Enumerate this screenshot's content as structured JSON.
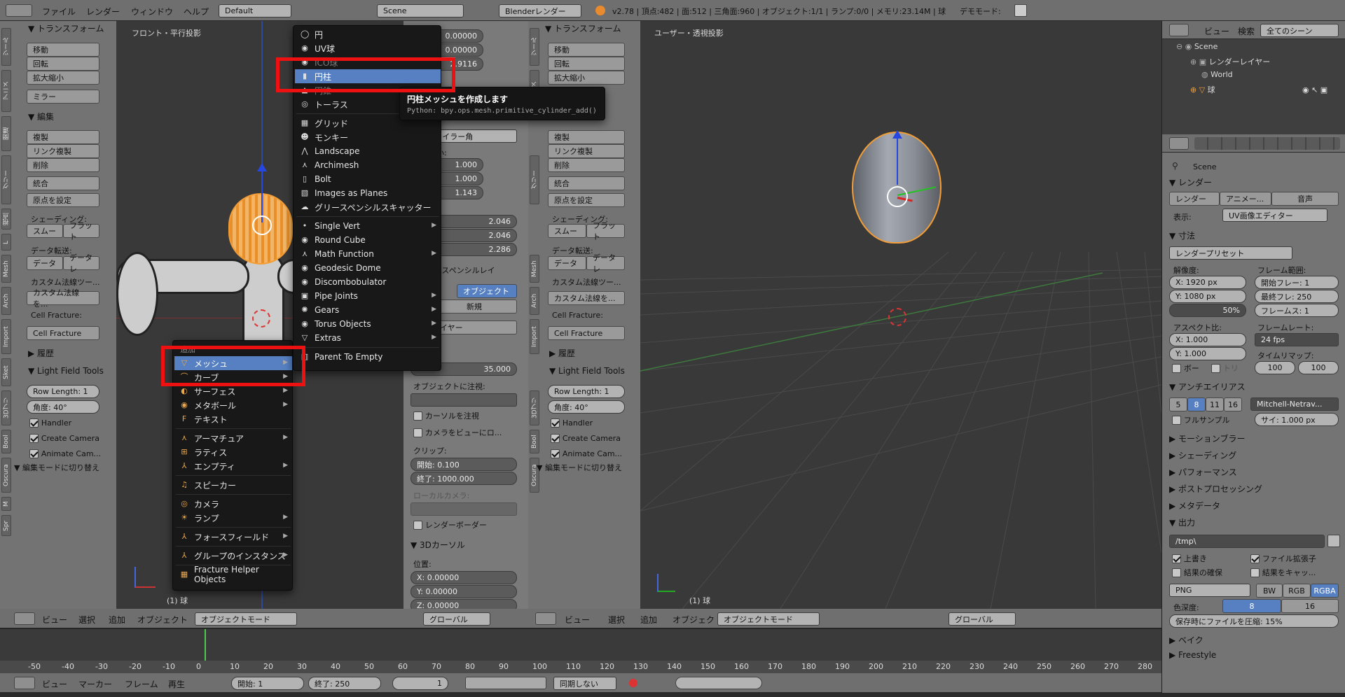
{
  "topbar": {
    "menus": [
      "ファイル",
      "レンダー",
      "ウィンドウ",
      "ヘルプ"
    ],
    "layout": "Default",
    "scene": "Scene",
    "engine": "Blenderレンダー",
    "stats": "v2.78 | 頂点:482 | 面:512 | 三角面:960 | オブジェクト:1/1 | ランプ:0/0 | メモリ:23.14M | 球",
    "demo": "デモモード:"
  },
  "left_tool": {
    "transform_header": "▼ トランスフォーム",
    "transform_btns": [
      "移動",
      "回転",
      "拡大縮小"
    ],
    "mirror": "ミラー",
    "edit_header": "▼ 編集",
    "edit_btns": [
      "複製",
      "リンク複製",
      "削除"
    ],
    "join": "統合",
    "origin": "原点を設定",
    "shading_label": "シェーディング:",
    "shading_btns": [
      "スムー",
      "フラット"
    ],
    "transfer_label": "データ転送:",
    "transfer_btns": [
      "データ",
      "データレ"
    ],
    "custom_label": "カスタム法線ツー...",
    "custom_btn": "カスタム法線を...",
    "cell_label": "Cell Fracture:",
    "cell_btn": "Cell Fracture",
    "history": "▶ 履歴",
    "lft_header": "▼ Light Field Tools",
    "row_length": "Row Length: 1",
    "angle": "角度:          40°",
    "checks": [
      "Handler",
      "Create Camera",
      "Animate Cam..."
    ],
    "editmode": "▼ 編集モードに切り替え"
  },
  "left_vp": {
    "title": "フロント・平行投影",
    "obj": "(1) 球"
  },
  "add_menu": {
    "title": "追加",
    "items": [
      {
        "label": "メッシュ",
        "sub": true,
        "sel": true
      },
      {
        "label": "カーブ",
        "sub": true
      },
      {
        "label": "サーフェス",
        "sub": true
      },
      {
        "label": "メタボール",
        "sub": true
      },
      {
        "label": "テキスト"
      },
      {
        "label": "アーマチュア",
        "sub": true
      },
      {
        "label": "ラティス"
      },
      {
        "label": "エンプティ",
        "sub": true
      },
      {
        "label": "スピーカー"
      },
      {
        "label": "カメラ"
      },
      {
        "label": "ランプ",
        "sub": true
      },
      {
        "label": "フォースフィールド",
        "sub": true
      },
      {
        "label": "グループのインスタンス",
        "sub": true
      },
      {
        "label": "Fracture Helper Objects"
      }
    ]
  },
  "mesh_menu": {
    "items": [
      {
        "label": "円",
        "icon": "circle-icon"
      },
      {
        "label": "UV球",
        "icon": "uv-sphere-icon"
      },
      {
        "label": "ICO球",
        "icon": "ico-sphere-icon"
      },
      {
        "label": "円柱",
        "icon": "cylinder-icon"
      },
      {
        "label": "円錐",
        "icon": "cone-icon"
      },
      {
        "label": "トーラス",
        "icon": "torus-icon"
      },
      {
        "label": "グリッド",
        "icon": "grid-icon"
      },
      {
        "label": "モンキー",
        "icon": "monkey-icon"
      },
      {
        "label": "Landscape",
        "icon": "landscape-icon"
      },
      {
        "label": "Archimesh",
        "icon": "archimesh-icon"
      },
      {
        "label": "Bolt",
        "icon": "bolt-icon"
      },
      {
        "label": "Images as Planes",
        "icon": "images-icon"
      },
      {
        "label": "グリースペンシルスキャッター",
        "icon": "gp-icon"
      },
      {
        "label": "Single Vert",
        "icon": "vert-icon"
      },
      {
        "label": "Round Cube",
        "icon": "roundcube-icon"
      },
      {
        "label": "Math Function",
        "icon": "math-icon"
      },
      {
        "label": "Geodesic Dome",
        "icon": "dome-icon"
      },
      {
        "label": "Discombobulator",
        "icon": "discombob-icon"
      },
      {
        "label": "Pipe Joints",
        "icon": "pipe-icon"
      },
      {
        "label": "Gears",
        "icon": "gears-icon"
      },
      {
        "label": "Torus Objects",
        "icon": "torusobj-icon"
      },
      {
        "label": "Extras",
        "icon": "extras-icon"
      },
      {
        "label": "Parent To Empty",
        "icon": "parent-icon"
      }
    ]
  },
  "tooltip": {
    "title": "円柱メッシュを作成します",
    "python": "Python: bpy.ops.mesh.primitive_cylinder_add()"
  },
  "npanel": {
    "loc": [
      "0.00000",
      "0.00000",
      "2.9116"
    ],
    "rotmode": "XYZ オイラー角",
    "dim_label": "拡大縮小:",
    "scale": [
      "1.000",
      "1.000",
      "1.143"
    ],
    "dims": [
      "2.046",
      "2.046",
      "2.286"
    ],
    "gp": "▼ グリースペンシルレイ",
    "gp_obj": "オブジェクト",
    "gp_new": "新規",
    "gp_layer": "新規レイヤー",
    "lens": "35.000",
    "lock_label": "オブジェクトに注視:",
    "cursor_lock": "カーソルを注視",
    "cam_view": "カメラをビューにロ...",
    "clip_label": "クリップ:",
    "clip_start": "開始:                0.100",
    "clip_end": "終了:           1000.000",
    "local_cam": "ローカルカメラ:",
    "render_border": "レンダーボーダー",
    "cursor_header": "▼ 3Dカーソル",
    "pos_label": "位置:",
    "cursor": [
      "X:          0.00000",
      "Y:          0.00000",
      "Z:          0.00000"
    ]
  },
  "right_vp": {
    "title": "ユーザー・透視投影",
    "obj": "(1) 球"
  },
  "header3d": {
    "menus": [
      "ビュー",
      "選択",
      "追加",
      "オブジェクト"
    ],
    "mode": "オブジェクトモード",
    "orient": "グローバル"
  },
  "outliner": {
    "menus": [
      "ビュー",
      "検索",
      "全てのシーン"
    ],
    "rows": [
      "Scene",
      "レンダーレイヤー",
      "World",
      "球"
    ]
  },
  "props": {
    "scene": "Scene",
    "render_header": "▼ レンダー",
    "render_btns": [
      "レンダー",
      "アニメー...",
      "音声"
    ],
    "display_label": "表示:",
    "display": "UV画像エディター",
    "dim_header": "▼ 寸法",
    "preset": "レンダープリセット",
    "res_label": "解像度:",
    "frame_label": "フレーム範囲:",
    "res_x": "X:       1920 px",
    "res_y": "Y:       1080 px",
    "res_pct": "50%",
    "f_start": "開始フレー:   1",
    "f_end": "最終フレ: 250",
    "f_step": "フレームス:   1",
    "aspect_label": "アスペクト比:",
    "fps_label": "フレームレート:",
    "asp_x": "X:       1.000",
    "asp_y": "Y:       1.000",
    "fps": "24 fps",
    "remap_label": "タイムリマップ:",
    "border": "ボー",
    "crop": "トリ",
    "remap": [
      "100",
      "100"
    ],
    "aa_header": "▼ アンチエイリアス",
    "aa": [
      "5",
      "8",
      "11",
      "16"
    ],
    "aa_filter": "Mitchell-Netrav...",
    "full_sample": "フルサンプル",
    "size": "サイ: 1.000 px",
    "sections": [
      "▶ モーションブラー",
      "▶ シェーディング",
      "▶ パフォーマンス",
      "▶ ポストプロセッシング",
      "▶ メタデータ"
    ],
    "output_header": "▼ 出力",
    "path": "/tmp\\",
    "overwrite": "上書き",
    "ext": "ファイル拡張子",
    "placeholders": "結果の確保",
    "cache": "結果をキャッ...",
    "format": "PNG",
    "bw": [
      "BW",
      "RGB",
      "RGBA"
    ],
    "depth_label": "色深度:",
    "depth": [
      "8",
      "16"
    ],
    "compress": "保存時にファイルを圧縮:           15%",
    "bake": "▶ ベイク",
    "freestyle": "▶ Freestyle"
  },
  "timeline": {
    "ticks": [
      "-50",
      "-40",
      "-30",
      "-20",
      "-10",
      "0",
      "10",
      "20",
      "30",
      "40",
      "50",
      "60",
      "70",
      "80",
      "90",
      "100",
      "110",
      "120",
      "130",
      "140",
      "150",
      "160",
      "170",
      "180",
      "190",
      "200",
      "210",
      "220",
      "230",
      "240",
      "250",
      "260",
      "270",
      "280"
    ],
    "menus": [
      "ビュー",
      "マーカー",
      "フレーム",
      "再生"
    ],
    "start": "開始:          1",
    "end": "終了:         250",
    "current": "1",
    "sync": "同期しない"
  }
}
